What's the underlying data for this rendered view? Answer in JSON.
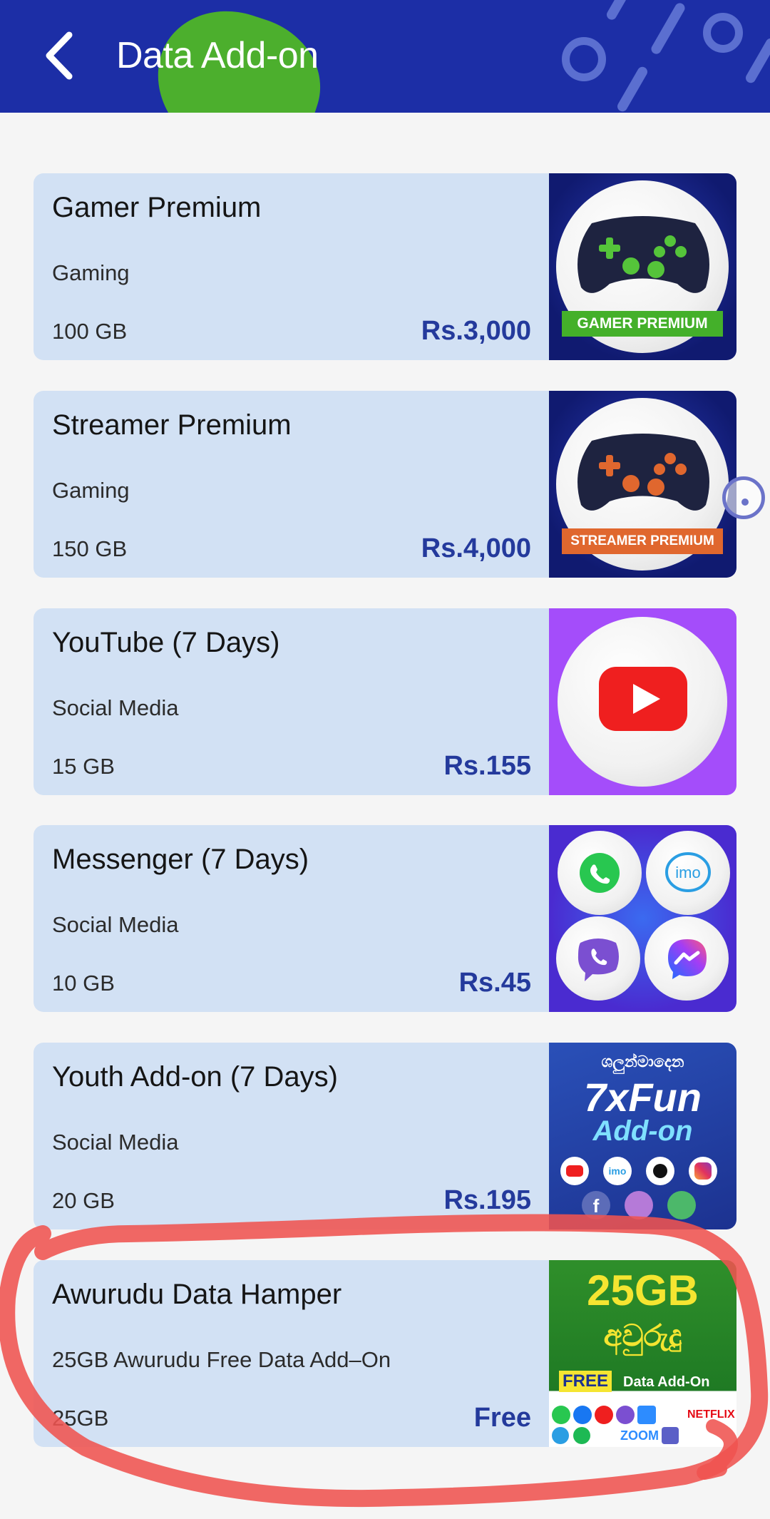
{
  "header": {
    "title": "Data Add-on",
    "back_icon": "chevron-left-icon",
    "background": "#1c2ea6",
    "accent": "#4caf2d"
  },
  "packages": [
    {
      "name": "Gamer Premium",
      "category": "Gaming",
      "volume": "100 GB",
      "price": "Rs.3,000",
      "image_label": "GAMER PREMIUM"
    },
    {
      "name": "Streamer Premium",
      "category": "Gaming",
      "volume": "150 GB",
      "price": "Rs.4,000",
      "image_label": "STREAMER PREMIUM"
    },
    {
      "name": "YouTube (7 Days)",
      "category": "Social Media",
      "volume": "15 GB",
      "price": "Rs.155"
    },
    {
      "name": "Messenger (7 Days)",
      "category": "Social Media",
      "volume": "10 GB",
      "price": "Rs.45",
      "image_label": "imo"
    },
    {
      "name": "Youth Add-on (7 Days)",
      "category": "Social Media",
      "volume": "20 GB",
      "price": "Rs.195",
      "image_label": "7xFun",
      "image_sub": "Add-on",
      "image_top": "ශලුන්මාදෙන"
    },
    {
      "name": "Awurudu Data Hamper",
      "category": "25GB Awurudu Free Data Add–On",
      "volume": "25GB",
      "price": "Free",
      "image_label": "25GB",
      "image_sub": "අවුරුදු",
      "image_tag": "FREE",
      "image_tag_rest": "Data Add-On",
      "image_brands": "ZOOM",
      "image_brands2": "NETFLIX"
    }
  ],
  "colors": {
    "card_bg": "#d2e1f4",
    "price": "#243a9c",
    "annotation": "#ef5350"
  }
}
